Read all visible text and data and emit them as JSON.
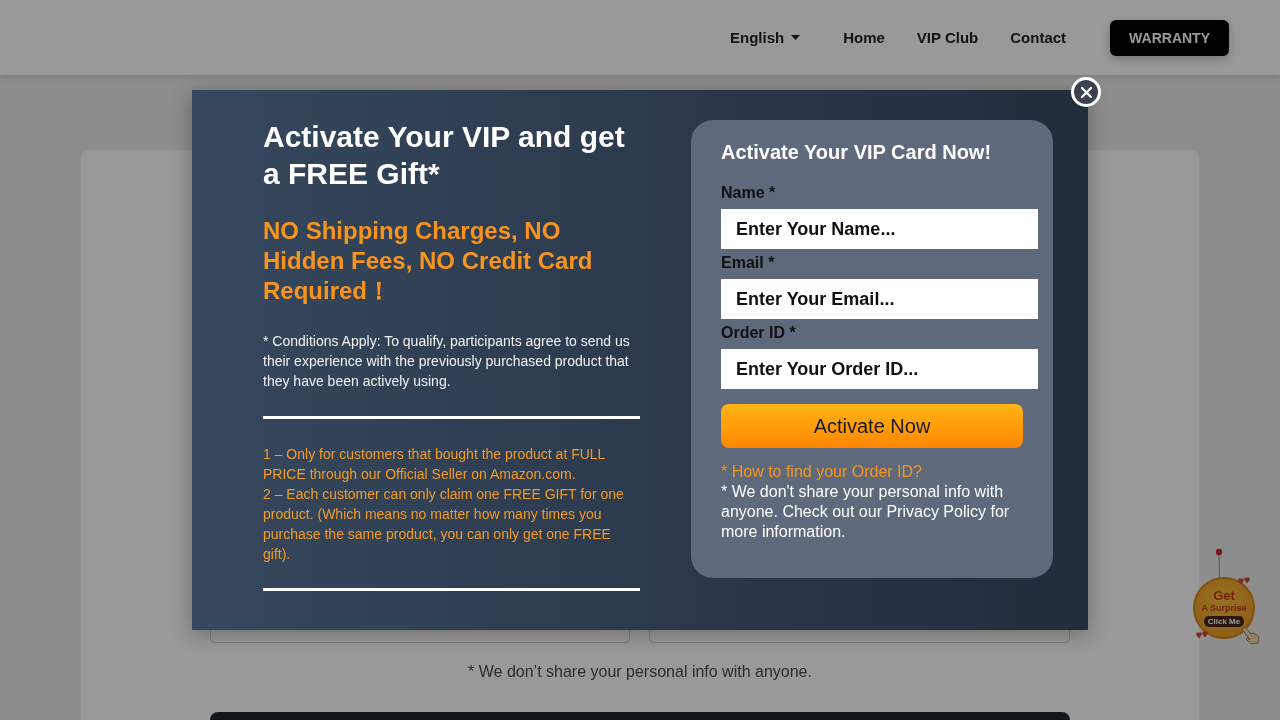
{
  "header": {
    "language": "English",
    "nav": [
      "Home",
      "VIP Club",
      "Contact"
    ],
    "cta": "WARRANTY"
  },
  "background_form": {
    "note": "* We don’t share your personal info with anyone."
  },
  "modal": {
    "title": "Activate Your VIP and get a FREE Gift*",
    "subtitle": "NO Shipping Charges, NO Hidden Fees, NO Credit Card Required！",
    "conditions": "* Conditions Apply: To qualify, participants agree to send us their experience with the previously purchased product that they have been actively using.",
    "rules": [
      "1 – Only for customers that bought the product at FULL PRICE through our Official Seller on Amazon.com.",
      "2 – Each customer can only claim one FREE GIFT for one product. (Which means no matter how many times you purchase the same product, you can only get one FREE gift)."
    ],
    "form": {
      "title": "Activate Your VIP Card Now!",
      "fields": [
        {
          "label": "Name *",
          "placeholder": "Enter Your Name..."
        },
        {
          "label": "Email *",
          "placeholder": "Enter Your Email..."
        },
        {
          "label": "Order ID *",
          "placeholder": "Enter Your Order ID..."
        }
      ],
      "submit": "Activate Now",
      "help_link": "* How to find your Order ID?",
      "privacy_note": "* We don't share your personal info with anyone. Check out our Privacy Policy for more information."
    }
  },
  "surprise_badge": {
    "title": "Get",
    "subtitle": "A Surprise",
    "action": "Click Me"
  }
}
